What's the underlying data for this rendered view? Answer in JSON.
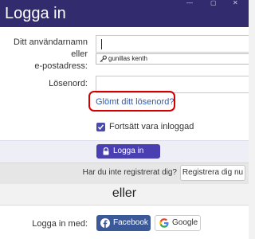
{
  "window": {
    "title": "Logga in"
  },
  "form": {
    "username_label_line1": "Ditt användarnamn eller",
    "username_label_line2": "e-postadress:",
    "username_value": "",
    "autofill_suggestion": "gunillas kenth",
    "password_label": "Lösenord:",
    "password_value": "",
    "forgot_link": "Glömt ditt lösenord?",
    "remember_label": "Fortsätt vara inloggad",
    "remember_checked": true,
    "login_button": "Logga in"
  },
  "register": {
    "question": "Har du inte registrerat dig?",
    "button": "Registrera dig nu"
  },
  "or_text": "eller",
  "social": {
    "label": "Logga in med:",
    "facebook": "Facebook",
    "google": "Google"
  },
  "colors": {
    "titlebar": "#322c6e",
    "primary_button": "#4a3fb0",
    "highlight": "#d40000",
    "link": "#2a5bc4",
    "facebook": "#3b5998"
  },
  "icons": {
    "autofill": "key-icon",
    "login": "lock-icon",
    "remember": "checkmark-icon",
    "facebook": "facebook-icon",
    "google": "google-icon"
  }
}
